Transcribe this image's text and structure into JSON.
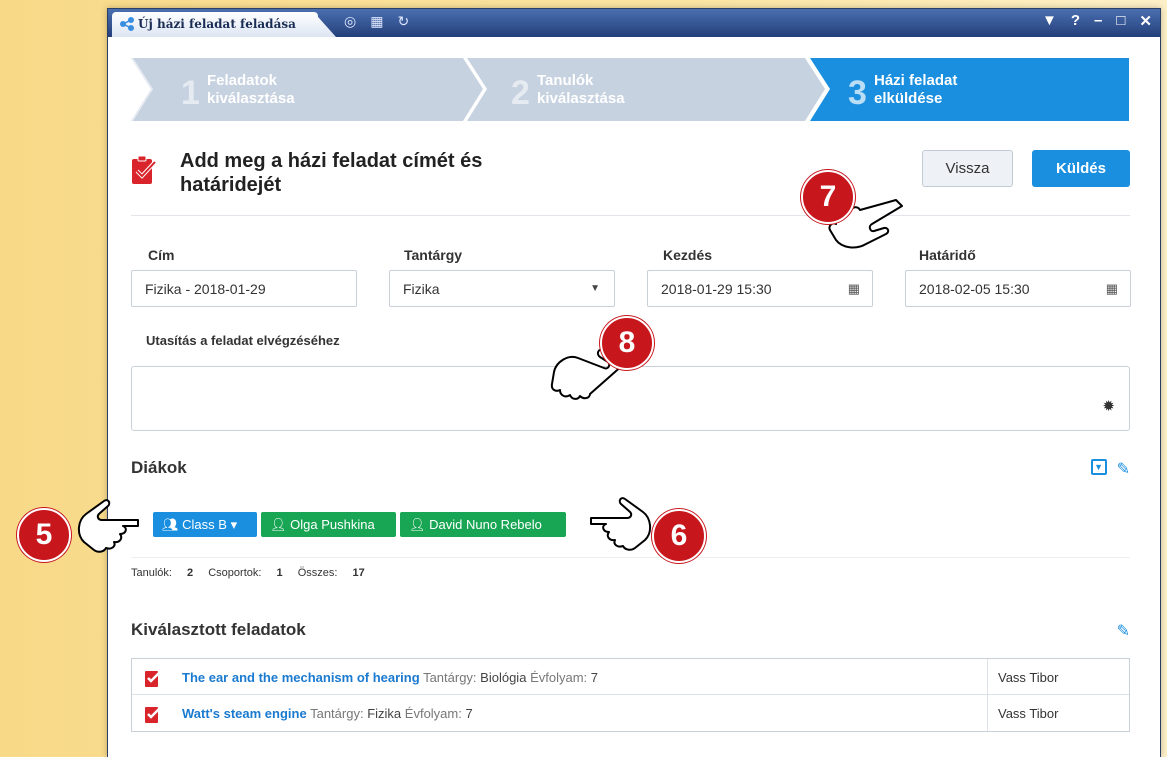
{
  "window": {
    "tab_title": "Új házi feladat feladása",
    "controls": [
      "▼",
      "?",
      "–",
      "□",
      "✕"
    ]
  },
  "wizard": {
    "steps": [
      {
        "num": "1",
        "label_line1": "Feladatok",
        "label_line2": "kiválasztása",
        "active": false
      },
      {
        "num": "2",
        "label_line1": "Tanulók",
        "label_line2": "kiválasztása",
        "active": false
      },
      {
        "num": "3",
        "label_line1": "Házi feladat",
        "label_line2": "elküldése",
        "active": true
      }
    ]
  },
  "header": {
    "title_line1": "Add meg a házi feladat címét és",
    "title_line2": "határidejét",
    "back_label": "Vissza",
    "send_label": "Küldés"
  },
  "form": {
    "title_label": "Cím",
    "title_value": "Fizika - 2018-01-29",
    "subject_label": "Tantárgy",
    "subject_value": "Fizika",
    "start_label": "Kezdés",
    "start_value": "2018-01-29 15:30",
    "deadline_label": "Határidő",
    "deadline_value": "2018-02-05 15:30",
    "instruction_label": "Utasítás a feladat elvégzéséhez",
    "instruction_value": ""
  },
  "students": {
    "title": "Diákok",
    "chips": [
      {
        "label": "Class B",
        "type": "group"
      },
      {
        "label": "Olga Pushkina",
        "type": "student"
      },
      {
        "label": "David Nuno Rebelo",
        "type": "student"
      }
    ],
    "stats": {
      "students_label": "Tanulók:",
      "students_value": "2",
      "groups_label": "Csoportok:",
      "groups_value": "1",
      "total_label": "Összes:",
      "total_value": "17"
    }
  },
  "selected_tasks": {
    "title": "Kiválasztott feladatok",
    "rows": [
      {
        "title": "The ear and the mechanism of hearing",
        "subject_label": "Tantárgy:",
        "subject": "Biológia",
        "grade_label": "Évfolyam:",
        "grade": "7",
        "teacher": "Vass Tibor"
      },
      {
        "title": "Watt's steam engine",
        "subject_label": "Tantárgy:",
        "subject": "Fizika",
        "grade_label": "Évfolyam:",
        "grade": "7",
        "teacher": "Vass Tibor"
      }
    ]
  },
  "callouts": [
    "5",
    "6",
    "7",
    "8"
  ],
  "colors": {
    "accent": "#1a8fe0",
    "green": "#18a654",
    "callout_red": "#c8161d",
    "task_icon_red": "#d9242b"
  }
}
